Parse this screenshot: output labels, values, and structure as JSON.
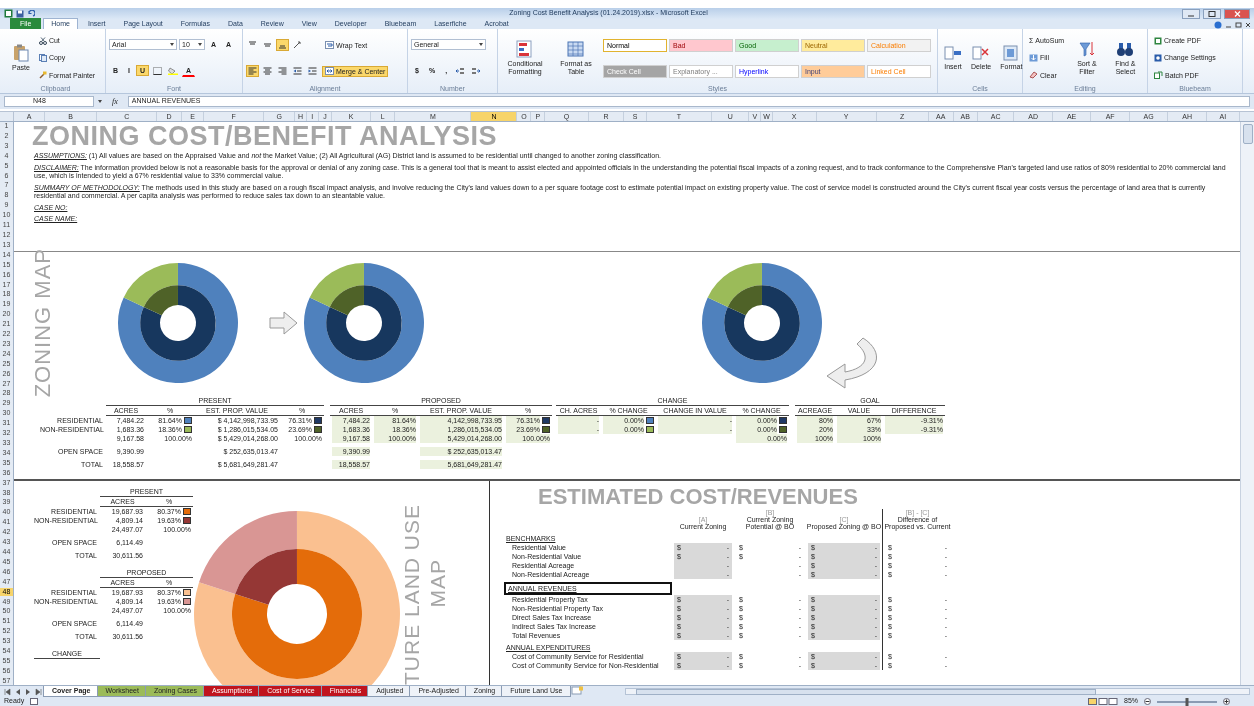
{
  "window": {
    "title": "Zoning Cost Benefit Analysis (01.24.2019).xlsx - Microsoft Excel"
  },
  "ribbon_tabs": [
    {
      "label": "File",
      "kind": "file",
      "selected": false
    },
    {
      "label": "Home",
      "kind": "tab",
      "selected": true
    },
    {
      "label": "Insert",
      "kind": "tab",
      "selected": false
    },
    {
      "label": "Page Layout",
      "kind": "tab",
      "selected": false
    },
    {
      "label": "Formulas",
      "kind": "tab",
      "selected": false
    },
    {
      "label": "Data",
      "kind": "tab",
      "selected": false
    },
    {
      "label": "Review",
      "kind": "tab",
      "selected": false
    },
    {
      "label": "View",
      "kind": "tab",
      "selected": false
    },
    {
      "label": "Developer",
      "kind": "tab",
      "selected": false
    },
    {
      "label": "Bluebeam",
      "kind": "tab",
      "selected": false
    },
    {
      "label": "Laserfiche",
      "kind": "tab",
      "selected": false
    },
    {
      "label": "Acrobat",
      "kind": "tab",
      "selected": false
    }
  ],
  "ribbon_groups": [
    {
      "label": "Clipboard",
      "columns": [
        [
          [
            {
              "kind": "big",
              "text": "Paste"
            }
          ]
        ],
        [
          [
            {
              "kind": "small",
              "text": "Cut"
            }
          ],
          [
            {
              "kind": "small",
              "text": "Copy"
            }
          ],
          [
            {
              "kind": "small",
              "text": "Format Painter"
            }
          ]
        ]
      ]
    },
    {
      "label": "Font",
      "columns": [
        [
          [
            {
              "kind": "field",
              "value": "Arial"
            },
            {
              "kind": "field",
              "value": "10"
            },
            {
              "kind": "glyph",
              "text": "A",
              "selected": false
            },
            {
              "kind": "glyph",
              "text": "A",
              "selected": false
            }
          ],
          [
            {
              "kind": "glyph",
              "text": "B",
              "selected": false
            },
            {
              "kind": "glyph",
              "text": "I",
              "selected": false
            },
            {
              "kind": "glyph",
              "text": "U",
              "selected": true
            },
            {
              "kind": "icon",
              "selected": false
            },
            {
              "kind": "icon",
              "selected": false
            },
            {
              "kind": "color_glyph",
              "text": "A",
              "color": "#ff0000"
            }
          ]
        ]
      ]
    },
    {
      "label": "Alignment",
      "columns": [
        [
          [
            {
              "kind": "icon",
              "selected": false
            },
            {
              "kind": "icon",
              "selected": false
            },
            {
              "kind": "icon",
              "selected": true
            },
            {
              "kind": "icon",
              "selected": false
            }
          ],
          [
            {
              "kind": "icon",
              "selected": true
            },
            {
              "kind": "icon",
              "selected": false
            },
            {
              "kind": "icon",
              "selected": false
            },
            {
              "kind": "icon",
              "selected": false
            },
            {
              "kind": "icon",
              "selected": false
            }
          ]
        ],
        [
          [
            {
              "kind": "small",
              "text": "Wrap Text",
              "selected": false
            }
          ],
          [
            {
              "kind": "small",
              "text": "Merge & Center",
              "selected": true
            }
          ]
        ]
      ]
    },
    {
      "label": "Number",
      "columns": [
        [
          [
            {
              "kind": "field",
              "value": "General"
            }
          ],
          [
            {
              "kind": "glyph",
              "text": "$",
              "selected": false
            },
            {
              "kind": "glyph",
              "text": "%",
              "selected": false
            },
            {
              "kind": "glyph",
              "text": ",",
              "selected": false
            },
            {
              "kind": "icon",
              "selected": false
            },
            {
              "kind": "icon",
              "selected": false
            }
          ]
        ]
      ]
    },
    {
      "label": "Styles",
      "columns": [
        [
          [
            {
              "kind": "big",
              "text": "Conditional Formatting"
            }
          ]
        ],
        [
          [
            {
              "kind": "big",
              "text": "Format as Table"
            }
          ]
        ],
        [
          [
            {
              "kind": "style",
              "text": "Normal",
              "color": "#ffffff",
              "selected": true
            },
            {
              "kind": "style",
              "text": "Bad",
              "color": "#ffc7ce",
              "selected": false
            },
            {
              "kind": "style",
              "text": "Good",
              "color": "#c6efce",
              "selected": false
            },
            {
              "kind": "style",
              "text": "Neutral",
              "color": "#ffeb9c",
              "selected": false
            },
            {
              "kind": "style",
              "text": "Calculation",
              "color": "#f2f2f2",
              "selected": false
            }
          ],
          [
            {
              "kind": "style",
              "text": "Check Cell",
              "color": "#a5a5a5",
              "selected": false
            },
            {
              "kind": "style",
              "text": "Explanatory ...",
              "color": "#ffffff",
              "selected": false
            },
            {
              "kind": "style",
              "text": "Hyperlink",
              "color": "#ffffff",
              "selected": false
            },
            {
              "kind": "style",
              "text": "Input",
              "color": "#ffcc99",
              "selected": false
            },
            {
              "kind": "style",
              "text": "Linked Cell",
              "color": "#ffffff",
              "selected": false
            }
          ]
        ]
      ]
    },
    {
      "label": "Cells",
      "columns": [
        [
          [
            {
              "kind": "big",
              "text": "Insert"
            }
          ]
        ],
        [
          [
            {
              "kind": "big",
              "text": "Delete"
            }
          ]
        ],
        [
          [
            {
              "kind": "big",
              "text": "Format"
            }
          ]
        ]
      ]
    },
    {
      "label": "Editing",
      "columns": [
        [
          [
            {
              "kind": "small",
              "glyph": "Σ",
              "text": "AutoSum"
            }
          ],
          [
            {
              "kind": "small",
              "text": "Fill"
            }
          ],
          [
            {
              "kind": "small",
              "text": "Clear"
            }
          ]
        ],
        [
          [
            {
              "kind": "big",
              "text": "Sort & Filter"
            }
          ]
        ],
        [
          [
            {
              "kind": "big",
              "text": "Find & Select"
            }
          ]
        ]
      ]
    },
    {
      "label": "Bluebeam",
      "columns": [
        [
          [
            {
              "kind": "small",
              "text": "Create PDF"
            }
          ],
          [
            {
              "kind": "small",
              "text": "Change Settings"
            }
          ],
          [
            {
              "kind": "small",
              "text": "Batch PDF"
            }
          ]
        ]
      ]
    }
  ],
  "formula_bar": {
    "cell": "N48",
    "function_label": "fx",
    "value": "ANNUAL REVENUES"
  },
  "column_headers": [
    {
      "label": "A",
      "selected": false
    },
    {
      "label": "B",
      "selected": false
    },
    {
      "label": "C",
      "selected": false
    },
    {
      "label": "D",
      "selected": false
    },
    {
      "label": "E",
      "selected": false
    },
    {
      "label": "F",
      "selected": false
    },
    {
      "label": "G",
      "selected": false
    },
    {
      "label": "H",
      "selected": false
    },
    {
      "label": "I",
      "selected": false
    },
    {
      "label": "J",
      "selected": false
    },
    {
      "label": "K",
      "selected": false
    },
    {
      "label": "L",
      "selected": false
    },
    {
      "label": "M",
      "selected": false
    },
    {
      "label": "N",
      "selected": true
    },
    {
      "label": "O",
      "selected": false
    },
    {
      "label": "P",
      "selected": false
    },
    {
      "label": "Q",
      "selected": false
    },
    {
      "label": "R",
      "selected": false
    },
    {
      "label": "S",
      "selected": false
    },
    {
      "label": "T",
      "selected": false
    },
    {
      "label": "U",
      "selected": false
    },
    {
      "label": "V",
      "selected": false
    },
    {
      "label": "W",
      "selected": false
    },
    {
      "label": "X",
      "selected": false
    },
    {
      "label": "Y",
      "selected": false
    },
    {
      "label": "Z",
      "selected": false
    },
    {
      "label": "AA",
      "selected": false
    },
    {
      "label": "AB",
      "selected": false
    },
    {
      "label": "AC",
      "selected": false
    },
    {
      "label": "AD",
      "selected": false
    },
    {
      "label": "AE",
      "selected": false
    },
    {
      "label": "AF",
      "selected": false
    },
    {
      "label": "AG",
      "selected": false
    },
    {
      "label": "AH",
      "selected": false
    },
    {
      "label": "AI",
      "selected": false
    }
  ],
  "row_headers": [
    {
      "label": "1",
      "selected": false
    },
    {
      "label": "2",
      "selected": false
    },
    {
      "label": "3",
      "selected": false
    },
    {
      "label": "4",
      "selected": false
    },
    {
      "label": "5",
      "selected": false
    },
    {
      "label": "6",
      "selected": false
    },
    {
      "label": "7",
      "selected": false
    },
    {
      "label": "8",
      "selected": false
    },
    {
      "label": "9",
      "selected": false
    },
    {
      "label": "10",
      "selected": false
    },
    {
      "label": "11",
      "selected": false
    },
    {
      "label": "12",
      "selected": false
    },
    {
      "label": "13",
      "selected": false
    },
    {
      "label": "14",
      "selected": false
    },
    {
      "label": "15",
      "selected": false
    },
    {
      "label": "16",
      "selected": false
    },
    {
      "label": "17",
      "selected": false
    },
    {
      "label": "18",
      "selected": false
    },
    {
      "label": "19",
      "selected": false
    },
    {
      "label": "20",
      "selected": false
    },
    {
      "label": "21",
      "selected": false
    },
    {
      "label": "22",
      "selected": false
    },
    {
      "label": "23",
      "selected": false
    },
    {
      "label": "24",
      "selected": false
    },
    {
      "label": "25",
      "selected": false
    },
    {
      "label": "26",
      "selected": false
    },
    {
      "label": "27",
      "selected": false
    },
    {
      "label": "28",
      "selected": false
    },
    {
      "label": "29",
      "selected": false
    },
    {
      "label": "30",
      "selected": false
    },
    {
      "label": "31",
      "selected": false
    },
    {
      "label": "32",
      "selected": false
    },
    {
      "label": "33",
      "selected": false
    },
    {
      "label": "34",
      "selected": false
    },
    {
      "label": "35",
      "selected": false
    },
    {
      "label": "36",
      "selected": false
    },
    {
      "label": "37",
      "selected": false
    },
    {
      "label": "38",
      "selected": false
    },
    {
      "label": "39",
      "selected": false
    },
    {
      "label": "40",
      "selected": false
    },
    {
      "label": "41",
      "selected": false
    },
    {
      "label": "42",
      "selected": false
    },
    {
      "label": "43",
      "selected": false
    },
    {
      "label": "44",
      "selected": false
    },
    {
      "label": "45",
      "selected": false
    },
    {
      "label": "46",
      "selected": false
    },
    {
      "label": "47",
      "selected": false
    },
    {
      "label": "48",
      "selected": true
    },
    {
      "label": "49",
      "selected": false
    },
    {
      "label": "50",
      "selected": false
    },
    {
      "label": "51",
      "selected": false
    },
    {
      "label": "52",
      "selected": false
    },
    {
      "label": "53",
      "selected": false
    },
    {
      "label": "54",
      "selected": false
    },
    {
      "label": "55",
      "selected": false
    },
    {
      "label": "56",
      "selected": false
    },
    {
      "label": "57",
      "selected": false
    }
  ],
  "sheet_title": "ZONING COST/BENEFIT ANALYSIS",
  "notes": [
    {
      "label": "ASSUMPTIONS:",
      "text": "(1) All values are based on the Appraised Value and *not* the Market Value; (2) All Agricultural (AG) District land is assumed to be residential until changed to another zoning classification."
    },
    {
      "label": "DISCLAIMER:",
      "text": "The information provided below is not a reasonable basis for the approval or denial of any zoning case.  This is a general tool that is meant to assist elected and appointed officials in the understanding the potential fiscal impacts of a zoning request, and to track conformance to the Comprehensive Plan's targeted land use ratios of 80% residential to 20% commercial land use, which is intended to yield a 67% residential value to 33% commercial value."
    },
    {
      "label": "SUMMARY OF METHODOLOGY:",
      "text": "The methods used in this study are based on a rough fiscal impact analysis, and involve reducing the City's land values down to a per square footage cost to estimate potential impact on existing property value.  The cost of service model is constructed around the City's current fiscal year costs versus the percentage of land area that is currently residential and commercial.  A per capita analysis was performed to reduce sales tax down to an steantable value."
    },
    {
      "label": "CASE NO:"
    },
    {
      "label": "CASE NAME:"
    }
  ],
  "zoning_map": {
    "label": "ZONING MAP"
  },
  "zoning_tables": {
    "blocks": [
      {
        "title": "PRESENT",
        "columns": [
          "ACRES",
          "%",
          "EST. PROP. VALUE",
          "%"
        ],
        "rows": [
          {
            "label": "RESIDENTIAL",
            "cells": [
              {
                "text": "7,484.22"
              },
              {
                "text": "81.64%",
                "color": "#4f81bd"
              },
              {
                "text": "$ 4,142,998,733.95"
              },
              {
                "text": "76.31%",
                "color": "#1f3864"
              }
            ]
          },
          {
            "label": "NON-RESIDENTIAL",
            "cells": [
              {
                "text": "1,683.36"
              },
              {
                "text": "18.36%",
                "color": "#9bbb59"
              },
              {
                "text": "$ 1,286,015,534.05"
              },
              {
                "text": "23.69%",
                "color": "#4f6228"
              }
            ]
          },
          {
            "cells": [
              {
                "text": "9,167.58"
              },
              {
                "text": "100.00%"
              },
              {
                "text": "$ 5,429,014,268.00"
              },
              {
                "text": "100.00%"
              }
            ]
          },
          {
            "label": "OPEN SPACE",
            "cells": [
              {
                "text": "9,390.99"
              },
              null,
              {
                "text": "$ 252,635,013.47"
              },
              null
            ]
          },
          {
            "label": "TOTAL",
            "cells": [
              {
                "text": "18,558.57"
              },
              null,
              {
                "text": "$ 5,681,649,281.47"
              },
              null
            ]
          }
        ]
      },
      {
        "title": "PROPOSED",
        "columns": [
          "ACRES",
          "%",
          "EST. PROP. VALUE",
          "%"
        ],
        "rows": [
          {
            "cells": [
              {
                "text": "7,484.22"
              },
              {
                "text": "81.64%"
              },
              {
                "text": "4,142,998,733.95"
              },
              {
                "text": "76.31%",
                "color": "#1f3864"
              }
            ]
          },
          {
            "cells": [
              {
                "text": "1,683.36"
              },
              {
                "text": "18.36%"
              },
              {
                "text": "1,286,015,534.05"
              },
              {
                "text": "23.69%",
                "color": "#4f6228"
              }
            ]
          },
          {
            "cells": [
              {
                "text": "9,167.58"
              },
              {
                "text": "100.00%"
              },
              {
                "text": "5,429,014,268.00"
              },
              {
                "text": "100.00%"
              }
            ]
          },
          {
            "cells": [
              {
                "text": "9,390.99"
              },
              null,
              {
                "text": "$ 252,635,013.47"
              },
              null
            ]
          },
          {
            "cells": [
              {
                "text": "18,558.57"
              },
              null,
              {
                "text": "5,681,649,281.47"
              },
              null
            ]
          }
        ]
      },
      {
        "title": "CHANGE",
        "columns": [
          "CH. ACRES",
          "% CHANGE",
          "CHANGE IN VALUE",
          "% CHANGE"
        ],
        "rows": [
          {
            "cells": [
              {
                "text": "-"
              },
              {
                "text": "0.00%",
                "color": "#4f81bd"
              },
              {
                "text": "-"
              },
              {
                "text": "0.00%",
                "color": "#1f3864"
              }
            ]
          },
          {
            "cells": [
              {
                "text": "-"
              },
              {
                "text": "0.00%",
                "color": "#9bbb59"
              },
              {
                "text": "-"
              },
              {
                "text": "0.00%",
                "color": "#4f6228"
              }
            ]
          },
          {
            "cells": [
              null,
              null,
              null,
              {
                "text": "0.00%"
              }
            ]
          }
        ]
      },
      {
        "title": "GOAL",
        "columns": [
          "ACREAGE",
          "VALUE",
          "DIFFERENCE"
        ],
        "rows": [
          {
            "cells": [
              {
                "text": "80%"
              },
              {
                "text": "67%"
              },
              {
                "text": "-9.31%"
              }
            ]
          },
          {
            "cells": [
              {
                "text": "20%"
              },
              {
                "text": "33%"
              },
              {
                "text": "-9.31%"
              }
            ]
          },
          {
            "cells": [
              {
                "text": "100%"
              },
              {
                "text": "100%"
              },
              null
            ]
          }
        ]
      }
    ]
  },
  "land_use_tables": {
    "blocks": [
      {
        "title": "PRESENT",
        "columns": [
          "ACRES",
          "%"
        ],
        "rows": [
          {
            "label": "RESIDENTIAL",
            "cells": [
              {
                "text": "19,687.93"
              },
              {
                "text": "80.37%",
                "color": "#e46c0a"
              }
            ]
          },
          {
            "label": "NON-RESIDENTIAL",
            "cells": [
              {
                "text": "4,809.14"
              },
              {
                "text": "19.63%",
                "color": "#953735"
              }
            ]
          },
          {
            "cells": [
              {
                "text": "24,497.07"
              },
              {
                "text": "100.00%"
              }
            ]
          },
          {
            "label": "OPEN SPACE",
            "cells": [
              {
                "text": "6,114.49"
              },
              null
            ]
          },
          {
            "label": "TOTAL",
            "cells": [
              {
                "text": "30,611.56"
              },
              null
            ]
          }
        ]
      },
      {
        "title": "PROPOSED",
        "columns": [
          "ACRES",
          "%"
        ],
        "rows": [
          {
            "label": "RESIDENTIAL",
            "cells": [
              {
                "text": "19,687.93"
              },
              {
                "text": "80.37%",
                "color": "#fac090"
              }
            ]
          },
          {
            "label": "NON-RESIDENTIAL",
            "cells": [
              {
                "text": "4,809.14"
              },
              {
                "text": "19.63%",
                "color": "#d99694"
              }
            ]
          },
          {
            "cells": [
              {
                "text": "24,497.07"
              },
              {
                "text": "100.00%"
              }
            ]
          },
          {
            "label": "OPEN SPACE",
            "cells": [
              {
                "text": "6,114.49"
              },
              null
            ]
          },
          {
            "label": "TOTAL",
            "cells": [
              {
                "text": "30,611.56"
              },
              null
            ]
          }
        ]
      },
      {
        "title": "CHANGE"
      }
    ]
  },
  "land_use_map": {
    "label": "TURE LAND USE",
    "label_2": "MAP"
  },
  "estimated": {
    "title": "ESTIMATED COST/REVENUES",
    "columns": [
      {
        "tag": "[A]",
        "title": "Current Zoning"
      },
      {
        "tag": "[B]",
        "title": "Current Zoning Potential @ BO"
      },
      {
        "tag": "[C]",
        "title": "Proposed Zoning @ BO"
      },
      {
        "tag": "[B] - [C]",
        "title": "Difference of Proposed vs. Current"
      }
    ],
    "sections": [
      {
        "title": "BENCHMARKS",
        "selected": false,
        "rows": [
          {
            "label": "Residential Value",
            "cells": [
              {
                "sign": "$",
                "value": "-",
                "shaded": true
              },
              {
                "sign": "$",
                "value": "-",
                "shaded": false
              },
              {
                "sign": "$",
                "value": "-",
                "shaded": true
              },
              {
                "sign": "$",
                "value": "-",
                "shaded": false
              }
            ]
          },
          {
            "label": "Non-Residential Value",
            "cells": [
              {
                "sign": "$",
                "value": "-",
                "shaded": true
              },
              {
                "sign": "$",
                "value": "-",
                "shaded": false
              },
              {
                "sign": "$",
                "value": "-",
                "shaded": true
              },
              {
                "sign": "$",
                "value": "-",
                "shaded": false
              }
            ]
          },
          {
            "label": "Residential Acreage",
            "cells": [
              {
                "value": "-",
                "shaded": true
              },
              {
                "value": "-",
                "shaded": false
              },
              {
                "sign": "$",
                "value": "-",
                "shaded": true
              },
              {
                "sign": "$",
                "value": "-",
                "shaded": false
              }
            ]
          },
          {
            "label": "Non-Residential Acreage",
            "cells": [
              {
                "value": "-",
                "shaded": true
              },
              {
                "value": "-",
                "shaded": false
              },
              {
                "sign": "$",
                "value": "-",
                "shaded": true
              },
              {
                "sign": "$",
                "value": "-",
                "shaded": false
              }
            ]
          }
        ]
      },
      {
        "title": "ANNUAL REVENUES",
        "selected": true,
        "rows": [
          {
            "label": "Residential Property Tax",
            "cells": [
              {
                "sign": "$",
                "value": "-",
                "shaded": true
              },
              {
                "sign": "$",
                "value": "-",
                "shaded": false
              },
              {
                "sign": "$",
                "value": "-",
                "shaded": true
              },
              {
                "sign": "$",
                "value": "-",
                "shaded": false
              }
            ]
          },
          {
            "label": "Non-Residential Property Tax",
            "cells": [
              {
                "sign": "$",
                "value": "-",
                "shaded": true
              },
              {
                "sign": "$",
                "value": "-",
                "shaded": false
              },
              {
                "sign": "$",
                "value": "-",
                "shaded": true
              },
              {
                "sign": "$",
                "value": "-",
                "shaded": false
              }
            ]
          },
          {
            "label": "Direct Sales Tax Increase",
            "cells": [
              {
                "sign": "$",
                "value": "-",
                "shaded": true
              },
              {
                "sign": "$",
                "value": "-",
                "shaded": false
              },
              {
                "sign": "$",
                "value": "-",
                "shaded": true
              },
              {
                "sign": "$",
                "value": "-",
                "shaded": false
              }
            ]
          },
          {
            "label": "Indirect Sales Tax Increase",
            "cells": [
              {
                "sign": "$",
                "value": "-",
                "shaded": true
              },
              {
                "sign": "$",
                "value": "-",
                "shaded": false
              },
              {
                "sign": "$",
                "value": "-",
                "shaded": true
              },
              {
                "sign": "$",
                "value": "-",
                "shaded": false
              }
            ]
          },
          {
            "label": "Total Revenues",
            "cells": [
              {
                "sign": "$",
                "value": "-",
                "shaded": true
              },
              {
                "sign": "$",
                "value": "-",
                "shaded": false
              },
              {
                "sign": "$",
                "value": "-",
                "shaded": true
              },
              {
                "sign": "$",
                "value": "-",
                "shaded": false
              }
            ]
          }
        ]
      },
      {
        "title": "ANNUAL EXPENDITURES",
        "selected": false,
        "rows": [
          {
            "label": "Cost of Community Service for Residential",
            "cells": [
              {
                "sign": "$",
                "value": "-",
                "shaded": true
              },
              {
                "sign": "$",
                "value": "-",
                "shaded": false
              },
              {
                "sign": "$",
                "value": "-",
                "shaded": true
              },
              {
                "sign": "$",
                "value": "-",
                "shaded": false
              }
            ]
          },
          {
            "label": "Cost of Community Service for Non-Residential",
            "cells": [
              {
                "sign": "$",
                "value": "-",
                "shaded": true
              },
              {
                "sign": "$",
                "value": "-",
                "shaded": false
              },
              {
                "sign": "$",
                "value": "-",
                "shaded": true
              },
              {
                "sign": "$",
                "value": "-",
                "shaded": false
              }
            ]
          }
        ]
      }
    ]
  },
  "sheet_tabs": [
    {
      "label": "Cover Page",
      "selected": true
    },
    {
      "label": "Worksheet",
      "color": "#9bbb59",
      "selected": false
    },
    {
      "label": "Zoning Cases",
      "color": "#9bbb59",
      "selected": false
    },
    {
      "label": "Assumptions",
      "color": "#c0141e",
      "selected": false
    },
    {
      "label": "Cost of Service",
      "color": "#c0141e",
      "selected": false
    },
    {
      "label": "Financials",
      "color": "#c0141e",
      "selected": false
    },
    {
      "label": "Adjusted",
      "selected": false
    },
    {
      "label": "Pre-Adjusted",
      "selected": false
    },
    {
      "label": "Zoning",
      "selected": false
    },
    {
      "label": "Future Land Use",
      "selected": false
    }
  ],
  "status_bar": {
    "mode": "Ready",
    "zoom": "85%",
    "level": 0.5
  }
}
